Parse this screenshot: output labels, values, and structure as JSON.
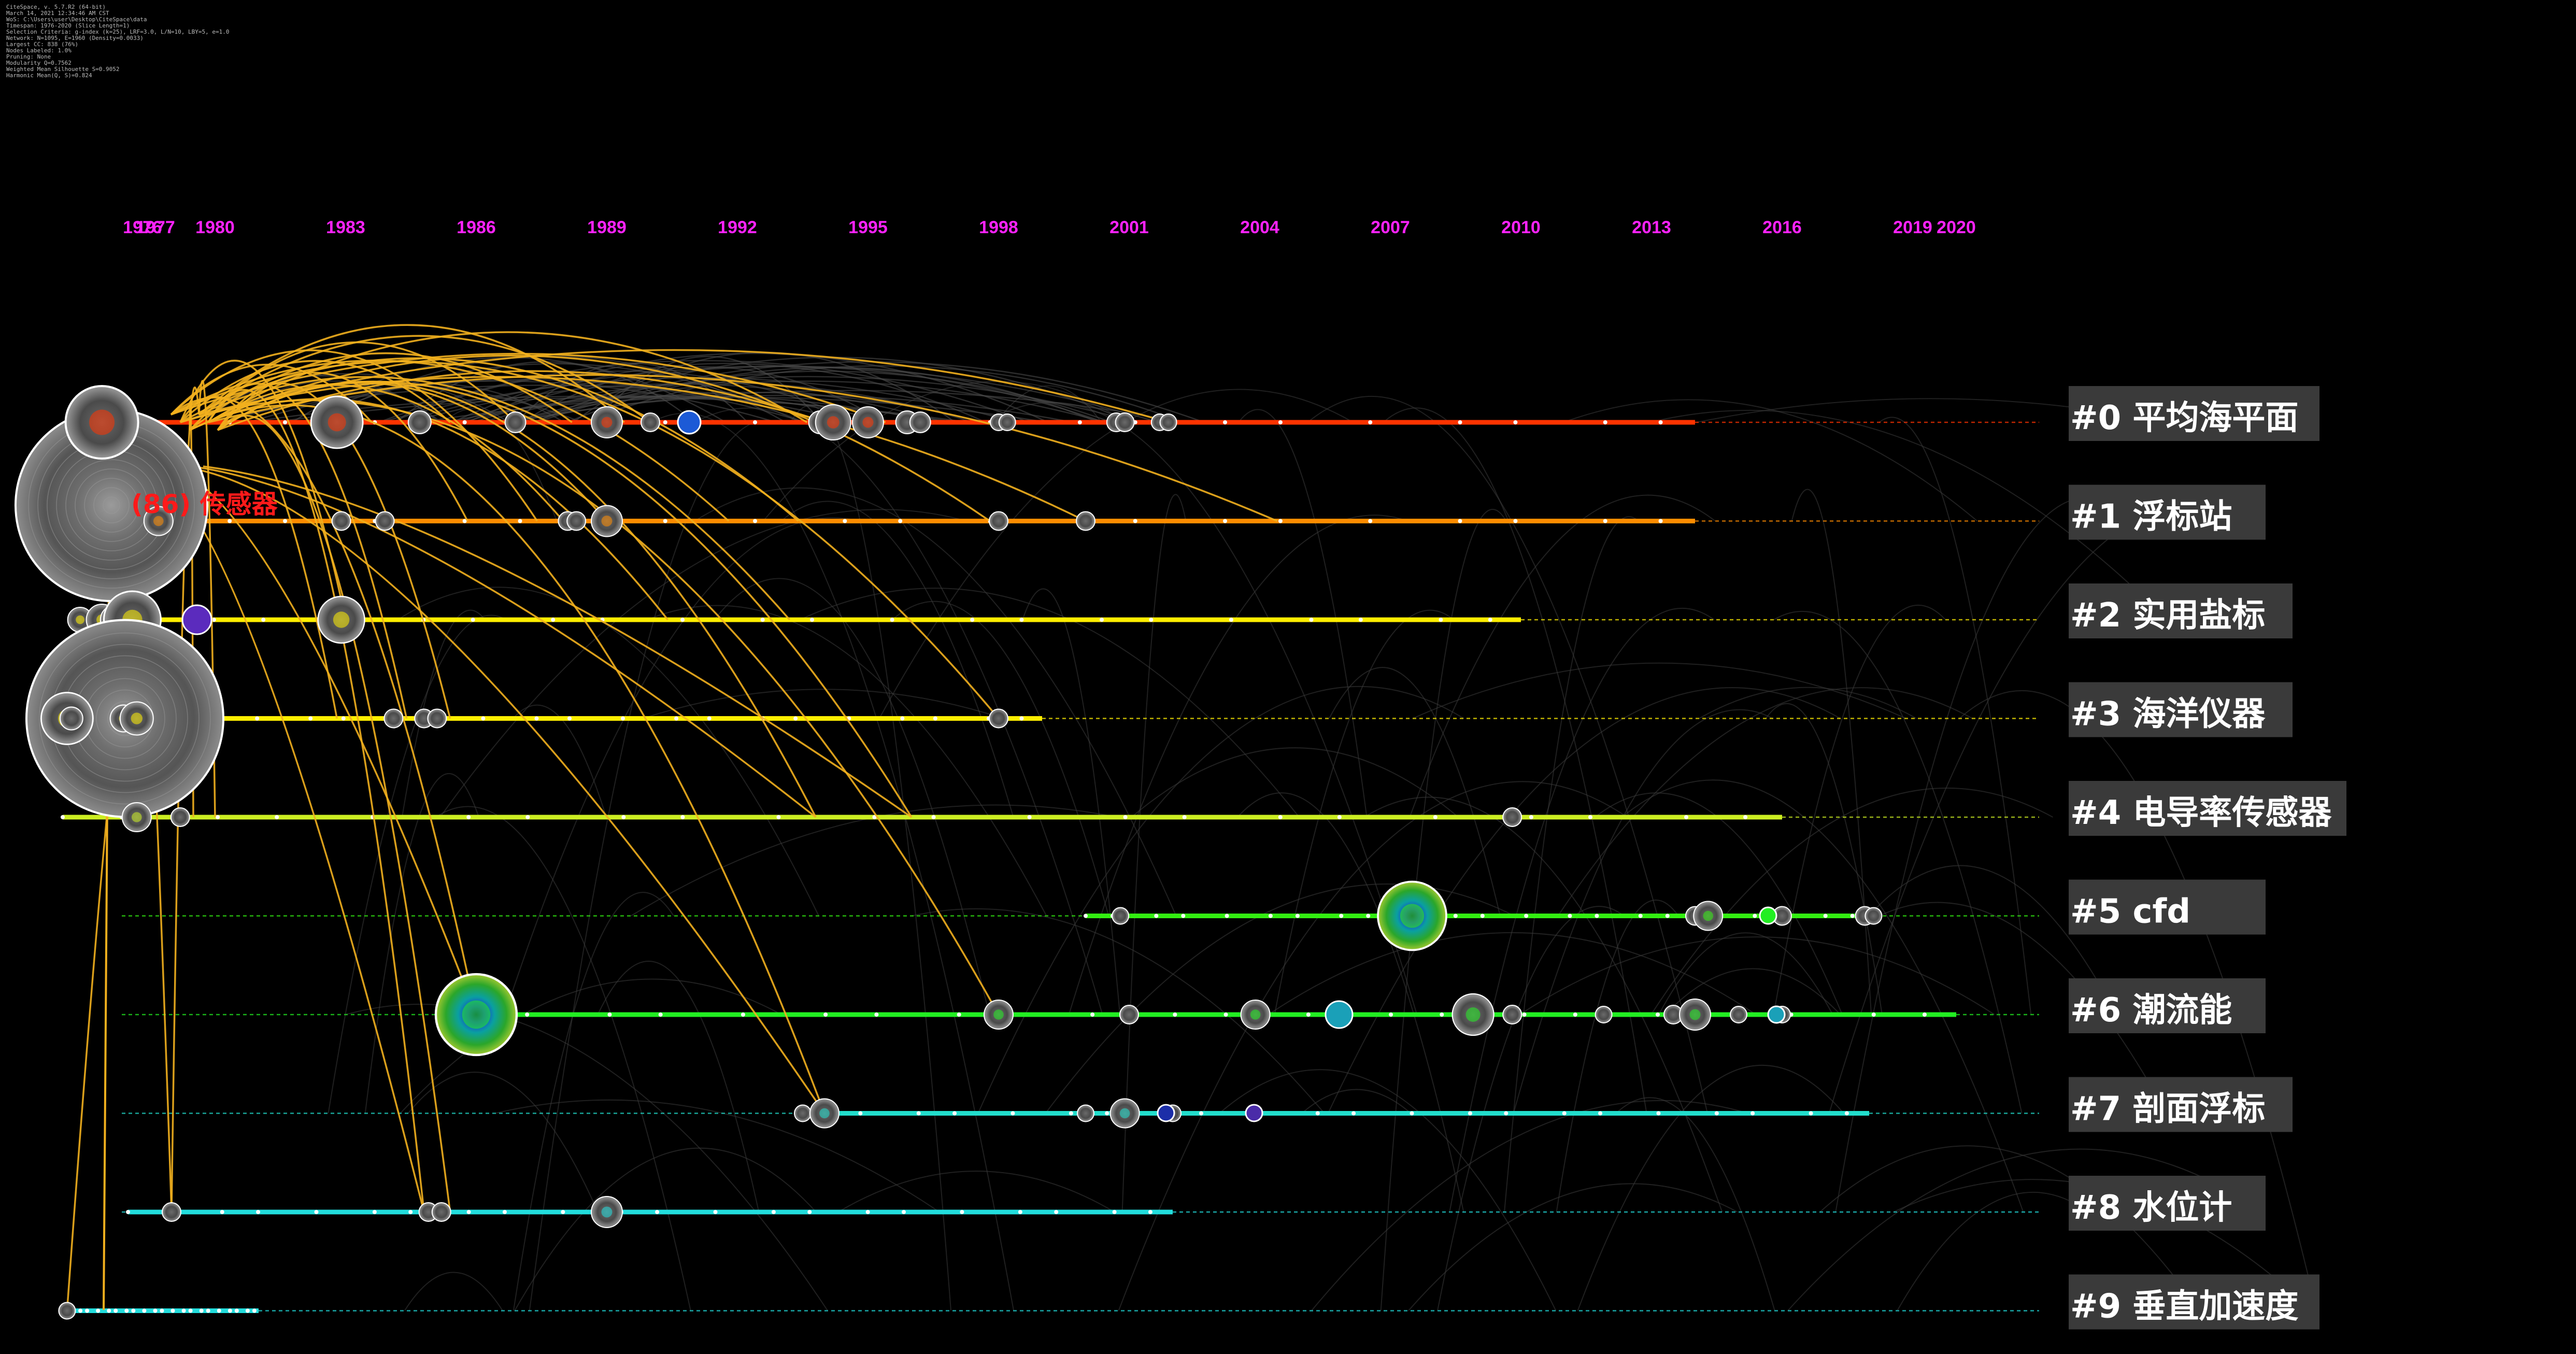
{
  "meta_lines": [
    "CiteSpace, v. 5.7.R2 (64-bit)",
    "March 14, 2021 12:34:46 AM CST",
    "WoS: C:\\Users\\user\\Desktop\\CiteSpace\\data",
    "Timespan: 1976-2020 (Slice Length=1)",
    "Selection Criteria: g-index (k=25), LRF=3.0, L/N=10, LBY=5, e=1.0",
    "Network: N=1095, E=1960 (Density=0.0033)",
    "Largest CC: 838 (76%)",
    "Nodes Labeled: 1.0%",
    "Pruning: None",
    "Modularity Q=0.7562",
    "Weighted Mean Silhouette S=0.9052",
    "Harmonic Mean(Q, S)=0.824"
  ],
  "highlight_label": "(86) 传感器",
  "chart_data": {
    "type": "timeline",
    "x_years": [
      1976,
      1977,
      1980,
      1983,
      1986,
      1989,
      1992,
      1995,
      1998,
      2001,
      2004,
      2007,
      2010,
      2013,
      2016,
      2019,
      2020
    ],
    "x_tick_labels": [
      "1976",
      "1977",
      "1980",
      "1983",
      "1986",
      "1989",
      "1992",
      "1995",
      "1998",
      "2001",
      "2004",
      "2007",
      "2010",
      "2013",
      "2016",
      "2019",
      "2020"
    ],
    "xlim": [
      1976,
      2020
    ],
    "tick_color": "#ff22ff",
    "clusters": [
      {
        "id": "#0",
        "label": "#0 平均海平面",
        "color": "#ff3300",
        "start": 1977,
        "end": 2014,
        "nodes": [
          [
            1977.4,
            70
          ],
          [
            1982.8,
            50
          ],
          [
            1984.7,
            22
          ],
          [
            1986.9,
            20
          ],
          [
            1989.0,
            30
          ],
          [
            1990.0,
            18
          ],
          [
            1993.9,
            22
          ],
          [
            1994.2,
            34
          ],
          [
            1995.0,
            30
          ],
          [
            1995.9,
            22
          ],
          [
            1996.2,
            20
          ],
          [
            1998.0,
            16
          ],
          [
            1998.2,
            16
          ],
          [
            2000.7,
            18
          ],
          [
            2000.9,
            18
          ],
          [
            2001.7,
            16
          ],
          [
            2001.9,
            16
          ]
        ]
      },
      {
        "id": "#1",
        "label": "#1 浮标站",
        "color": "#ff8c00",
        "start": 1977,
        "end": 2014,
        "nodes": [
          [
            1978.7,
            28
          ],
          [
            1982.9,
            18
          ],
          [
            1983.9,
            18
          ],
          [
            1988.1,
            18
          ],
          [
            1988.3,
            18
          ],
          [
            1989.0,
            30
          ],
          [
            1998.0,
            18
          ],
          [
            2000.0,
            18
          ]
        ]
      },
      {
        "id": "#2",
        "label": "#2 实用盐标",
        "color": "#ffee00",
        "start": 1977,
        "end": 2010,
        "nodes": [
          [
            1976.9,
            24
          ],
          [
            1977.4,
            30
          ],
          [
            1977.7,
            28
          ],
          [
            1978.1,
            55
          ],
          [
            1982.6,
            18
          ],
          [
            1982.9,
            45
          ]
        ]
      },
      {
        "id": "#3",
        "label": "#3 海洋仪器",
        "color": "#ffee00",
        "start": 1977,
        "end": 1999,
        "nodes": [
          [
            1976.5,
            190
          ],
          [
            1976.6,
            50
          ],
          [
            1976.7,
            22
          ],
          [
            1977.9,
            26
          ],
          [
            1978.2,
            32
          ],
          [
            1984.1,
            18
          ],
          [
            1984.8,
            18
          ],
          [
            1985.1,
            18
          ],
          [
            1998.0,
            18
          ]
        ]
      },
      {
        "id": "#4",
        "label": "#4 电导率传感器",
        "color": "#ccee22",
        "start": 1976.5,
        "end": 2016,
        "nodes": [
          [
            1978.2,
            28
          ],
          [
            1979.2,
            18
          ],
          [
            2009.8,
            18
          ]
        ]
      },
      {
        "id": "#5",
        "label": "#5 cfd",
        "color": "#33ee11",
        "start": 2000,
        "end": 2018,
        "nodes": [
          [
            2000.8,
            16
          ],
          [
            2007.5,
            66
          ],
          [
            2014.0,
            18
          ],
          [
            2014.3,
            28
          ],
          [
            2016.0,
            18
          ],
          [
            2017.9,
            18
          ],
          [
            2018.1,
            16
          ]
        ]
      },
      {
        "id": "#6",
        "label": "#6 潮流能",
        "color": "#22ee22",
        "start": 1986,
        "end": 2020,
        "nodes": [
          [
            1986.0,
            78
          ],
          [
            1998.0,
            28
          ],
          [
            2001.0,
            18
          ],
          [
            2003.9,
            28
          ],
          [
            2008.9,
            40
          ],
          [
            2009.8,
            18
          ],
          [
            2011.9,
            16
          ],
          [
            2013.5,
            18
          ],
          [
            2014.0,
            30
          ],
          [
            2015.0,
            16
          ],
          [
            2016.0,
            16
          ]
        ]
      },
      {
        "id": "#7",
        "label": "#7 剖面浮标",
        "color": "#22ddcc",
        "start": 1994,
        "end": 2018,
        "nodes": [
          [
            1993.5,
            16
          ],
          [
            1994.0,
            28
          ],
          [
            2000.0,
            16
          ],
          [
            2000.9,
            28
          ],
          [
            2002.0,
            16
          ]
        ]
      },
      {
        "id": "#8",
        "label": "#8 水位计",
        "color": "#22dddd",
        "start": 1978,
        "end": 2002,
        "nodes": [
          [
            1979.0,
            18
          ],
          [
            1984.9,
            18
          ],
          [
            1985.2,
            18
          ],
          [
            1989.0,
            30
          ]
        ]
      },
      {
        "id": "#9",
        "label": "#9 垂直加速度",
        "color": "#22dddd",
        "start": 1976.5,
        "end": 1981,
        "nodes": [
          [
            1976.6,
            16
          ]
        ]
      }
    ]
  }
}
